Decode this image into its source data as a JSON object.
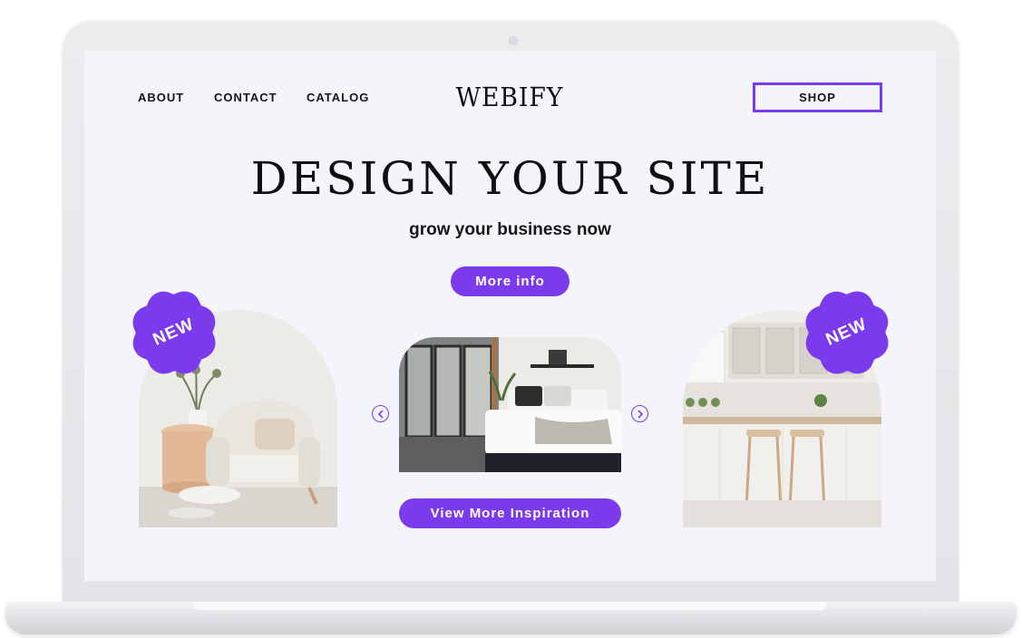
{
  "nav": {
    "about": "ABOUT",
    "contact": "CONTACT",
    "catalog": "CATALOG",
    "logo": "WEBIFY",
    "shop": "SHOP"
  },
  "hero": {
    "headline": "DESIGN YOUR SITE",
    "subheadline": "grow your business now",
    "cta_label": "More info"
  },
  "gallery": {
    "badge_left": "NEW",
    "badge_right": "NEW",
    "images": [
      "living-room-armchair",
      "bedroom",
      "kitchen-bar-stools"
    ],
    "prev_icon": "chevron-left-icon",
    "next_icon": "chevron-right-icon",
    "view_more_label": "View More Inspiration"
  },
  "colors": {
    "accent": "#7c3aed",
    "screen_bg": "#f4f5fa",
    "text": "#141414"
  }
}
